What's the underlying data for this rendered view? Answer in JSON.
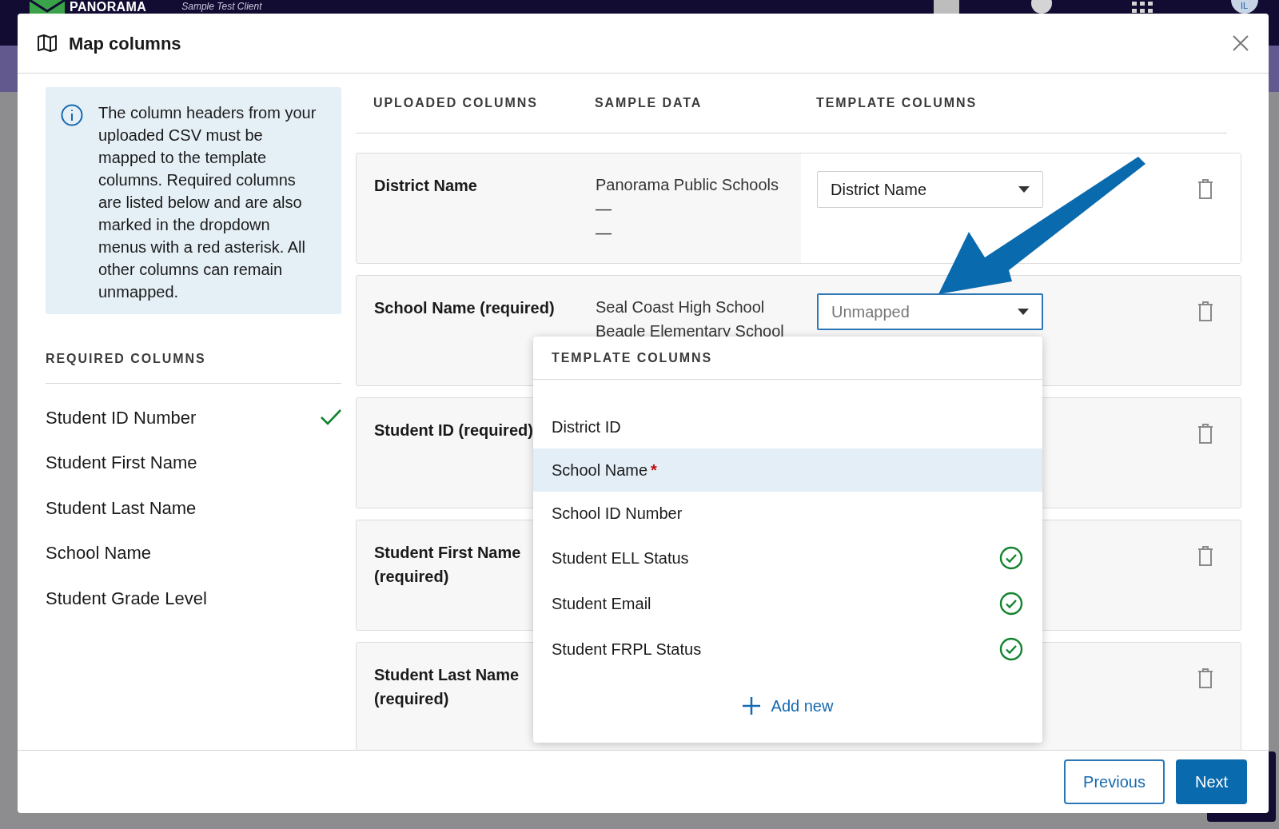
{
  "app_bar": {
    "logo": "PANORAMA",
    "client": "Sample Test Client",
    "avatar": "IL"
  },
  "dialog": {
    "title": "Map columns"
  },
  "info": "The column headers from your uploaded CSV must be mapped to the template columns. Required columns are listed below and are also marked in the dropdown menus with a red asterisk. All other columns can remain unmapped.",
  "required_columns": {
    "heading": "REQUIRED COLUMNS",
    "items": [
      {
        "label": "Student ID Number",
        "checked": true
      },
      {
        "label": "Student First Name",
        "checked": false
      },
      {
        "label": "Student Last Name",
        "checked": false
      },
      {
        "label": "School Name",
        "checked": false
      },
      {
        "label": "Student Grade Level",
        "checked": false
      }
    ]
  },
  "table": {
    "columns": [
      "UPLOADED COLUMNS",
      "SAMPLE DATA",
      "TEMPLATE COLUMNS"
    ],
    "rows": [
      {
        "uploaded": "District Name",
        "samples": [
          "Panorama Public Schools",
          "—",
          "—"
        ],
        "template": {
          "value": "District Name"
        },
        "focused": false
      },
      {
        "uploaded": "School Name (required)",
        "samples": [
          "Seal Coast High School",
          "Beagle Elementary School"
        ],
        "template": {
          "placeholder": "Unmapped"
        },
        "focused": true
      },
      {
        "uploaded": "Student ID (required)"
      },
      {
        "uploaded": "Student First Name (required)"
      },
      {
        "uploaded": "Student Last Name (required)"
      }
    ]
  },
  "dropdown": {
    "heading": "TEMPLATE COLUMNS",
    "required_mark": "*",
    "options": [
      {
        "label": "District ID",
        "required": false,
        "mapped": false,
        "selected": false
      },
      {
        "label": "School Name",
        "required": true,
        "mapped": false,
        "selected": true
      },
      {
        "label": "School ID Number",
        "required": false,
        "mapped": false,
        "selected": false
      },
      {
        "label": "Student ELL Status",
        "required": false,
        "mapped": true,
        "selected": false
      },
      {
        "label": "Student Email",
        "required": false,
        "mapped": true,
        "selected": false
      },
      {
        "label": "Student FRPL Status",
        "required": false,
        "mapped": true,
        "selected": false
      }
    ],
    "add_new": "Add new"
  },
  "buttons": [
    {
      "label": "Previous",
      "kind": "secondary"
    },
    {
      "label": "Next",
      "kind": "primary"
    }
  ]
}
